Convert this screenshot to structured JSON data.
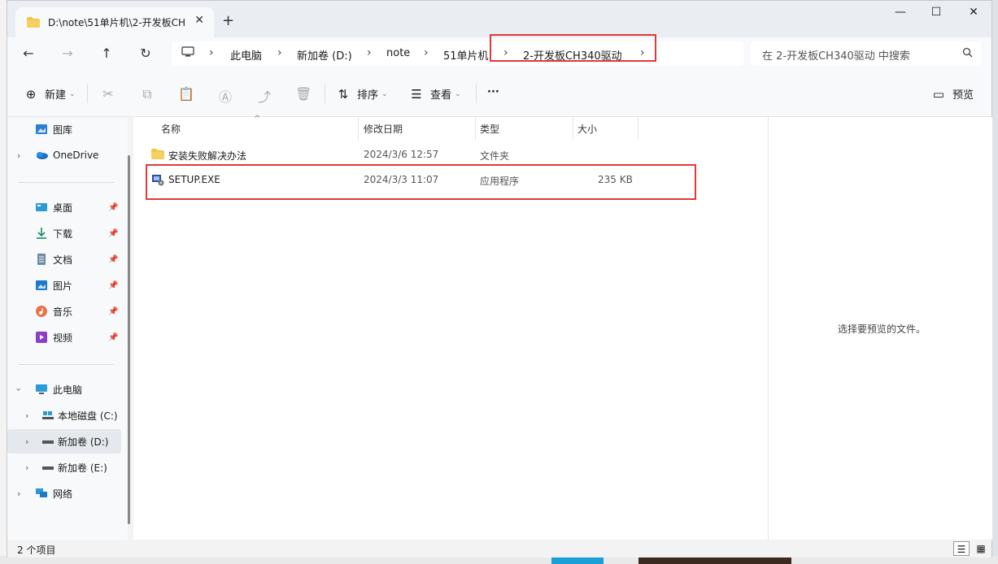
{
  "window": {
    "tab_title": "D:\\note\\51单片机\\2-开发板CH340驱动",
    "tab_close": "✕",
    "new_tab": "+",
    "minimize": "—",
    "maximize": "☐",
    "close": "✕"
  },
  "nav_buttons": {
    "back": "←",
    "forward": "→",
    "up": "↑",
    "refresh": "↻"
  },
  "breadcrumb": {
    "items": [
      "此电脑",
      "新加卷 (D:)",
      "note",
      "51单片机",
      "2-开发板CH340驱动"
    ],
    "separator": "›"
  },
  "search": {
    "placeholder": "在 2-开发板CH340驱动 中搜索"
  },
  "toolbar": {
    "new_label": "新建",
    "sort_label": "排序",
    "view_label": "查看",
    "more": "···",
    "preview_label": "预览"
  },
  "sidebar": {
    "items": [
      {
        "label": "图库",
        "icon": "gallery-icon"
      },
      {
        "label": "OneDrive",
        "icon": "cloud-icon"
      },
      {
        "label": "桌面",
        "icon": "desktop-icon"
      },
      {
        "label": "下载",
        "icon": "download-icon"
      },
      {
        "label": "文档",
        "icon": "document-icon"
      },
      {
        "label": "图片",
        "icon": "picture-icon"
      },
      {
        "label": "音乐",
        "icon": "music-icon"
      },
      {
        "label": "视频",
        "icon": "video-icon"
      },
      {
        "label": "此电脑",
        "icon": "computer-icon"
      },
      {
        "label": "本地磁盘 (C:)",
        "icon": "drive-icon"
      },
      {
        "label": "新加卷 (D:)",
        "icon": "drive-icon"
      },
      {
        "label": "新加卷 (E:)",
        "icon": "drive-icon"
      },
      {
        "label": "网络",
        "icon": "network-icon"
      }
    ]
  },
  "filelist": {
    "columns": [
      "名称",
      "修改日期",
      "类型",
      "大小"
    ],
    "rows": [
      {
        "name": "安装失败解决办法",
        "date": "2024/3/6 12:57",
        "type": "文件夹",
        "size": ""
      },
      {
        "name": "SETUP.EXE",
        "date": "2024/3/3 11:07",
        "type": "应用程序",
        "size": "235 KB"
      }
    ]
  },
  "preview": {
    "empty_text": "选择要预览的文件。"
  },
  "status": {
    "item_count": "2 个项目"
  },
  "colors": {
    "highlight": "#e03a3a",
    "folder": "#f4c542",
    "accent": "#0067c0"
  }
}
